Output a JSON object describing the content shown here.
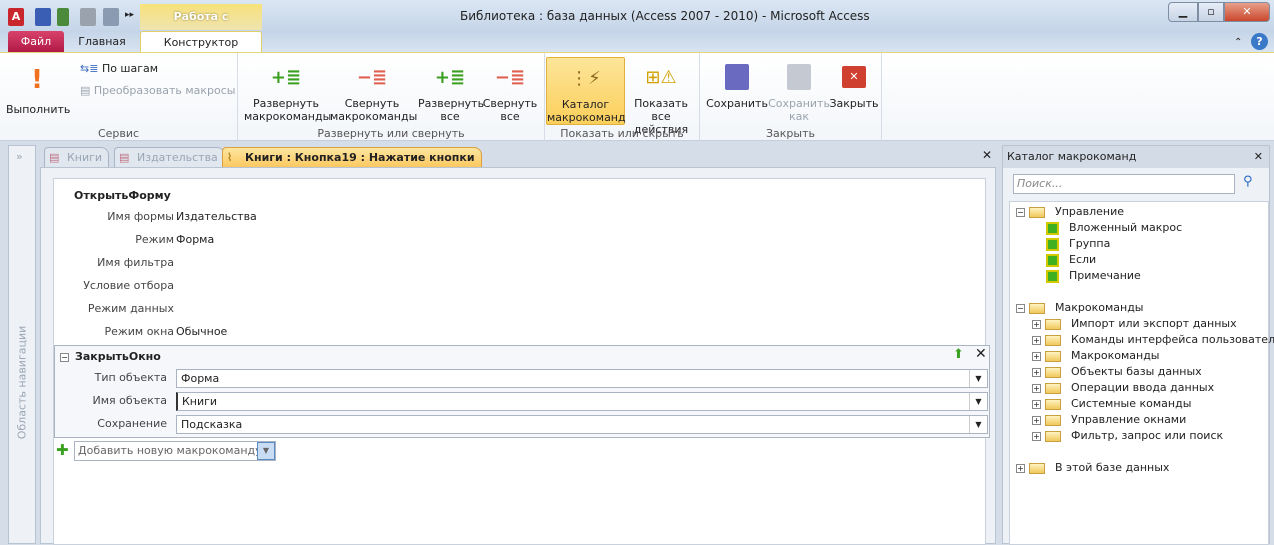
{
  "window": {
    "title": "Библиотека : база данных (Access 2007 - 2010)  -  Microsoft Access",
    "contextual_tab": "Работа с макросами"
  },
  "tabs": [
    {
      "label": "Файл"
    },
    {
      "label": "Главная"
    },
    {
      "label": "Конструктор"
    }
  ],
  "ribbon": {
    "groups": [
      {
        "label": "Сервис",
        "buttons": [
          "Выполнить",
          "По шагам",
          "Преобразовать макросы"
        ]
      },
      {
        "label": "Развернуть или свернуть",
        "buttons": [
          [
            "Развернуть",
            "макрокоманды"
          ],
          [
            "Свернуть",
            "макрокоманды"
          ],
          [
            "Развернуть",
            "все"
          ],
          [
            "Свернуть",
            "все"
          ]
        ]
      },
      {
        "label": "Показать или скрыть",
        "buttons": [
          [
            "Каталог",
            "макрокоманд"
          ],
          [
            "Показать",
            "все действия"
          ]
        ]
      },
      {
        "label": "Закрыть",
        "buttons": [
          [
            "Сохранить",
            ""
          ],
          [
            "Сохранить",
            "как"
          ],
          [
            "Закрыть",
            ""
          ]
        ]
      }
    ]
  },
  "nav": {
    "label": "Область навигации",
    "toggle": "»"
  },
  "doc_tabs": [
    {
      "label": "Книги"
    },
    {
      "label": "Издательства"
    },
    {
      "label": "Книги : Кнопка19 : Нажатие кнопки"
    }
  ],
  "macro": {
    "open_form": {
      "title": "ОткрытьФорму",
      "args": [
        {
          "label": "Имя формы",
          "value": "Издательства"
        },
        {
          "label": "Режим",
          "value": "Форма"
        },
        {
          "label": "Имя фильтра",
          "value": ""
        },
        {
          "label": "Условие отбора",
          "value": ""
        },
        {
          "label": "Режим данных",
          "value": ""
        },
        {
          "label": "Режим окна",
          "value": "Обычное"
        }
      ]
    },
    "close_window": {
      "title": "ЗакрытьОкно",
      "args": [
        {
          "label": "Тип объекта",
          "value": "Форма"
        },
        {
          "label": "Имя объекта",
          "value": "Книги"
        },
        {
          "label": "Сохранение",
          "value": "Подсказка"
        }
      ]
    },
    "add_placeholder": "Добавить новую макрокоманду"
  },
  "catalog": {
    "title": "Каталог макрокоманд",
    "search_placeholder": "Поиск...",
    "control": {
      "label": "Управление",
      "items": [
        "Вложенный макрос",
        "Группа",
        "Если",
        "Примечание"
      ]
    },
    "actions": {
      "label": "Макрокоманды",
      "items": [
        "Импорт или экспорт данных",
        "Команды интерфейса пользователя",
        "Макрокоманды",
        "Объекты базы данных",
        "Операции ввода данных",
        "Системные команды",
        "Управление окнами",
        "Фильтр, запрос или поиск"
      ]
    },
    "db": {
      "label": "В этой базе данных"
    }
  }
}
